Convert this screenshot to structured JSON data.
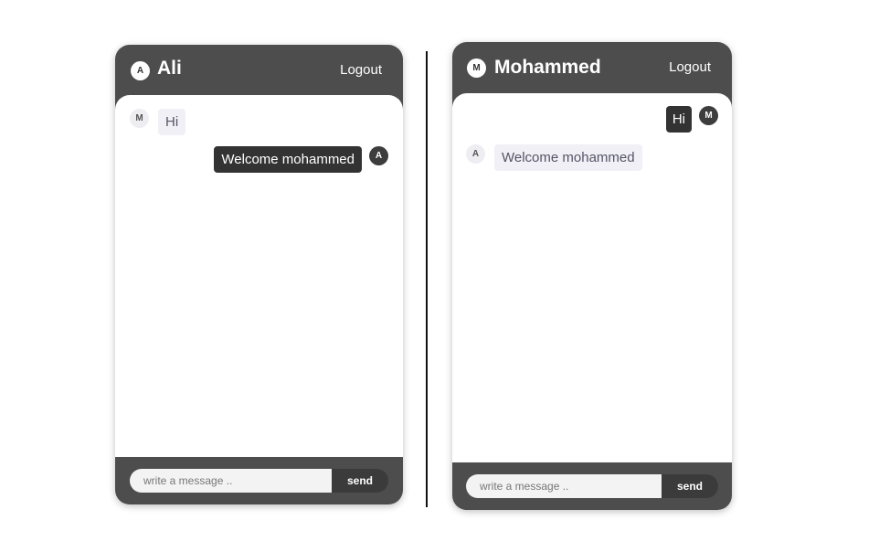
{
  "left_chat": {
    "user_initial": "A",
    "user_name": "Ali",
    "logout_label": "Logout",
    "messages": [
      {
        "from": "other",
        "initial": "M",
        "text": "Hi"
      },
      {
        "from": "self",
        "initial": "A",
        "text": "Welcome mohammed"
      }
    ],
    "input_placeholder": "write a message ..",
    "send_label": "send"
  },
  "right_chat": {
    "user_initial": "M",
    "user_name": "Mohammed",
    "logout_label": "Logout",
    "messages": [
      {
        "from": "self",
        "initial": "M",
        "text": "Hi"
      },
      {
        "from": "other",
        "initial": "A",
        "text": "Welcome mohammed"
      }
    ],
    "input_placeholder": "write a message ..",
    "send_label": "send"
  },
  "colors": {
    "panel": "#4d4d4d",
    "outgoing_bubble": "#333333",
    "incoming_bubble": "#f1f0f6"
  }
}
